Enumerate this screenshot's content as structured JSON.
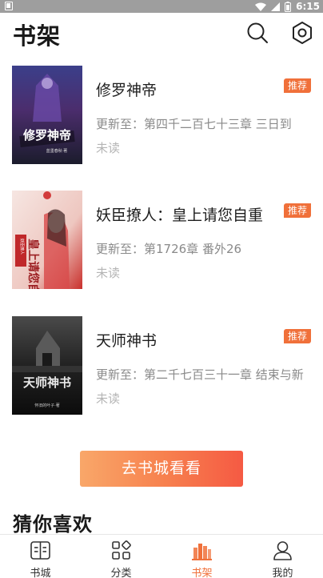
{
  "status_bar": {
    "time": "6:15"
  },
  "header": {
    "title": "书架",
    "search_icon": "search-icon",
    "settings_icon": "settings-icon"
  },
  "books": [
    {
      "title": "修罗神帝",
      "update": "更新至：第四千二百七十三章 三日到",
      "status": "未读",
      "badge": "推荐",
      "cover_text": "修罗神帝",
      "cover_author": "蓝墨春秋·著"
    },
    {
      "title": "妖臣撩人：皇上请您自重",
      "update": "更新至：第1726章 番外26",
      "status": "未读",
      "badge": "推荐",
      "cover_text": "皇上请您自重",
      "cover_author": "妖臣撩人"
    },
    {
      "title": "天师神书",
      "update": "更新至：第二千七百三十一章 结束与新",
      "status": "未读",
      "badge": "推荐",
      "cover_text": "天师神书",
      "cover_author": "怀旧的叶子·著"
    }
  ],
  "cta": {
    "label": "去书城看看"
  },
  "recommend": {
    "title": "猜你喜欢"
  },
  "bottom_nav": {
    "items": [
      {
        "label": "书城",
        "icon": "bookstore-icon"
      },
      {
        "label": "分类",
        "icon": "category-icon"
      },
      {
        "label": "书架",
        "icon": "bookshelf-icon"
      },
      {
        "label": "我的",
        "icon": "profile-icon"
      }
    ],
    "active": "书架",
    "active_color": "#f0703a"
  },
  "colors": {
    "accent": "#f0703a",
    "cta_start": "#f9a769",
    "cta_end": "#f55a43"
  }
}
